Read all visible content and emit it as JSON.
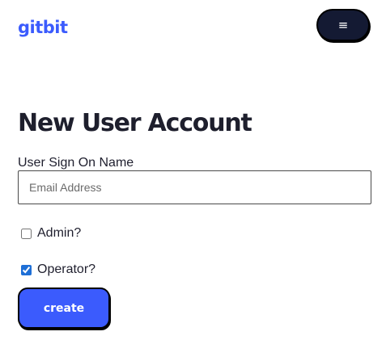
{
  "header": {
    "logo_text": "gitbit",
    "menu_icon": "hamburger-icon",
    "menu_glyph": "≡"
  },
  "main": {
    "title": "New User Account",
    "sign_on_label": "User Sign On Name",
    "email_input": {
      "value": "",
      "placeholder": "Email Address"
    },
    "admin_checkbox": {
      "label": "Admin?",
      "checked": false
    },
    "operator_checkbox": {
      "label": "Operator?",
      "checked": true
    },
    "create_button_label": "create"
  },
  "colors": {
    "brand": "#3b5bfd",
    "menu_button_bg": "#141a33",
    "text": "#1f1f2e"
  }
}
